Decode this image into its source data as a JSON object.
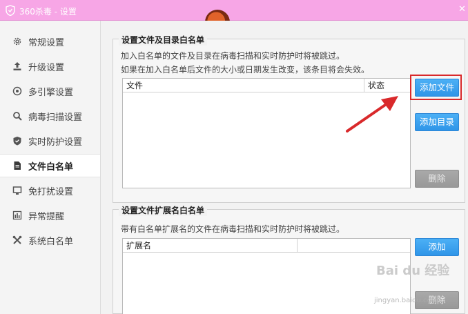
{
  "window": {
    "title": "360杀毒 - 设置"
  },
  "sidebar": {
    "items": [
      {
        "label": "常规设置",
        "icon": "gear-icon"
      },
      {
        "label": "升级设置",
        "icon": "upload-icon"
      },
      {
        "label": "多引擎设置",
        "icon": "engine-icon"
      },
      {
        "label": "病毒扫描设置",
        "icon": "search-icon"
      },
      {
        "label": "实时防护设置",
        "icon": "shield-icon"
      },
      {
        "label": "文件白名单",
        "icon": "document-icon",
        "active": true
      },
      {
        "label": "免打扰设置",
        "icon": "monitor-icon"
      },
      {
        "label": "异常提醒",
        "icon": "bar-chart-icon"
      },
      {
        "label": "系统白名单",
        "icon": "tools-icon"
      }
    ]
  },
  "file_whitelist": {
    "title": "设置文件及目录白名单",
    "desc1": "加入白名单的文件及目录在病毒扫描和实时防护时将被跳过。",
    "desc2": "如果在加入白名单后文件的大小或日期发生改变，该条目将会失效。",
    "columns": [
      "文件",
      "状态"
    ],
    "add_file_label": "添加文件",
    "add_dir_label": "添加目录",
    "delete_label": "删除"
  },
  "ext_whitelist": {
    "title": "设置文件扩展名白名单",
    "desc": "带有白名单扩展名的文件在病毒扫描和实时防护时将被跳过。",
    "columns": [
      "扩展名"
    ],
    "add_label": "添加",
    "delete_label": "删除"
  },
  "watermark": {
    "text": "Bai du 经验",
    "sub": "jingyan.baidu.com"
  },
  "colors": {
    "titlebar": "#f7a6e6",
    "button": "#2f95e8",
    "highlight": "#d9292b",
    "arrow": "#d9292b"
  }
}
